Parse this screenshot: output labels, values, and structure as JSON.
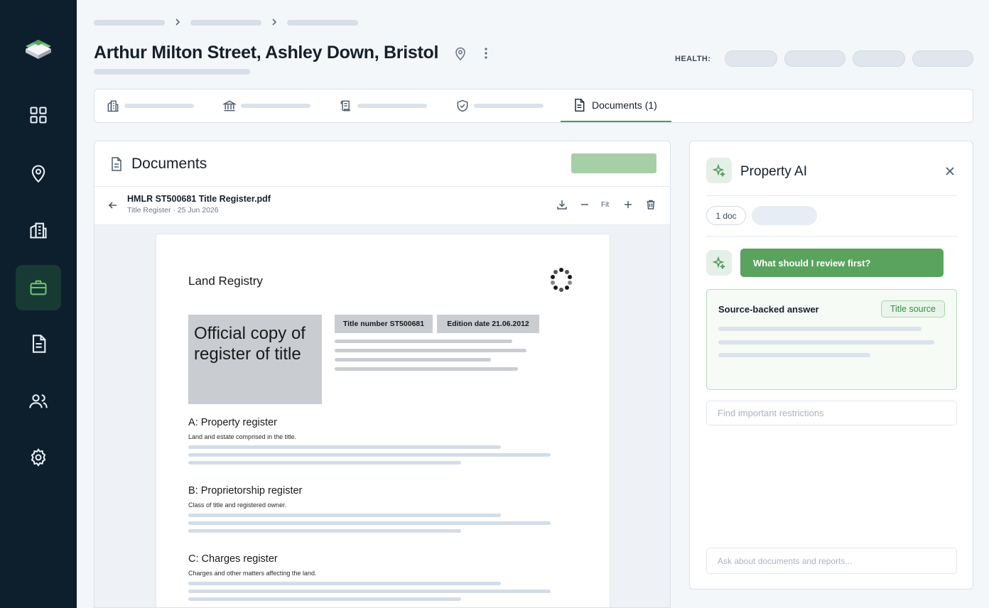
{
  "header": {
    "title": "Arthur Milton Street, Ashley Down, Bristol",
    "health_label": "HEALTH:"
  },
  "tabs": [
    {
      "icon": "building-icon",
      "label": ""
    },
    {
      "icon": "bank-icon",
      "label": ""
    },
    {
      "icon": "scroll-icon",
      "label": ""
    },
    {
      "icon": "shield-check-icon",
      "label": ""
    },
    {
      "icon": "document-icon",
      "label": "Documents (1)",
      "active": true
    }
  ],
  "sidebar": {
    "items": [
      {
        "icon": "grid-icon"
      },
      {
        "icon": "location-pin-icon"
      },
      {
        "icon": "buildings-icon"
      },
      {
        "icon": "briefcase-icon",
        "active": true
      },
      {
        "icon": "document-icon"
      },
      {
        "icon": "users-icon"
      },
      {
        "icon": "gear-icon"
      }
    ]
  },
  "documents": {
    "title": "Documents",
    "file": {
      "name": "HMLR ST500681 Title Register.pdf",
      "meta": "Title Register · 25 Jun 2026"
    },
    "toolbar": {
      "fit_label": "Fit"
    },
    "page": {
      "heading": "Land Registry",
      "copy_title": "Official copy of register of title",
      "title_number": "Title number ST500681",
      "edition_date": "Edition date 21.06.2012",
      "sections": [
        {
          "title": "A: Property register",
          "subtitle": "Land and estate comprised in the title."
        },
        {
          "title": "B: Proprietorship register",
          "subtitle": "Class of title and registered owner."
        },
        {
          "title": "C: Charges register",
          "subtitle": "Charges and other matters affecting the land."
        }
      ]
    }
  },
  "ai": {
    "title": "Property AI",
    "chip_doc": "1 doc",
    "question": "What should I review first?",
    "answer_title": "Source-backed answer",
    "source_tag": "Title source",
    "search_placeholder": "Find important restrictions",
    "ask_placeholder": "Ask about documents and reports..."
  },
  "colors": {
    "sidebar_bg": "#0d1f2d",
    "accent_green": "#5aa35e",
    "active_nav": "#173b33"
  }
}
